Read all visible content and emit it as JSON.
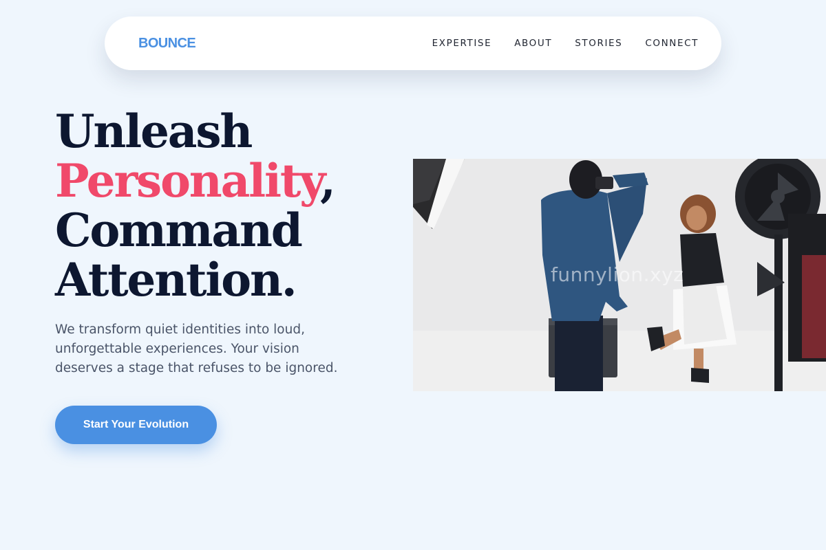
{
  "nav": {
    "brand": "BOUNCE",
    "links": [
      "EXPERTISE",
      "ABOUT",
      "STORIES",
      "CONNECT"
    ]
  },
  "hero": {
    "title_line1": "Unleash",
    "title_accent": "Personality",
    "title_comma": ",",
    "title_line3": "Command",
    "title_line4": "Attention.",
    "description": "We transform quiet identities into loud, unforgettable experiences. Your vision deserves a stage that refuses to be ignored.",
    "cta_label": "Start Your Evolution"
  },
  "photo": {
    "watermark": "funnylion.xyz"
  },
  "colors": {
    "background": "#eff6fd",
    "brand": "#4a90e2",
    "accent": "#f0496a",
    "heading": "#0d1730",
    "body_text": "#4a5468"
  }
}
